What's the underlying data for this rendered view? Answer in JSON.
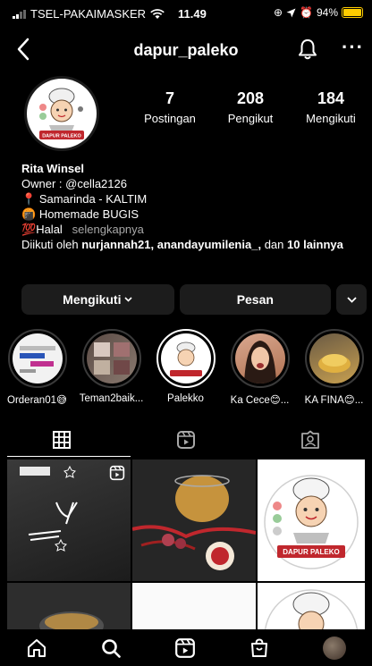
{
  "status": {
    "carrier": "TSEL-PAKAIMASKER",
    "time": "11.49",
    "battery": "94%"
  },
  "nav": {
    "username": "dapur_paleko"
  },
  "avatar": {
    "logo_text": "DAPUR PALEKO"
  },
  "stats": [
    {
      "value": "7",
      "label": "Postingan"
    },
    {
      "value": "208",
      "label": "Pengikut"
    },
    {
      "value": "184",
      "label": "Mengikuti"
    }
  ],
  "bio": {
    "name": "Rita Winsel",
    "owner": "Owner : @cella2126",
    "location_icon": "📍",
    "location": "Samarinda - KALTIM",
    "homemade_icon": "🍘",
    "homemade": "Homemade BUGIS",
    "halal_icon": "💯",
    "halal": "Halal",
    "more": "selengkapnya",
    "followed_prefix": "Diikuti oleh",
    "followed_names": "nurjannah21, anandayumilenia_,",
    "followed_mid": "dan",
    "followed_count": "10 lainnya"
  },
  "buttons": {
    "following": "Mengikuti",
    "message": "Pesan"
  },
  "highlights": [
    {
      "label": "Orderan01😅"
    },
    {
      "label": "Teman2baik..."
    },
    {
      "label": "Palekko"
    },
    {
      "label": "Ka Cece😊..."
    },
    {
      "label": "KA FINA😊..."
    }
  ],
  "grid": {
    "post4_text": "DAPUR PALEKO"
  },
  "colors": {
    "background": "#000000",
    "accent_red": "#c0272d",
    "battery": "#ffcc00"
  }
}
